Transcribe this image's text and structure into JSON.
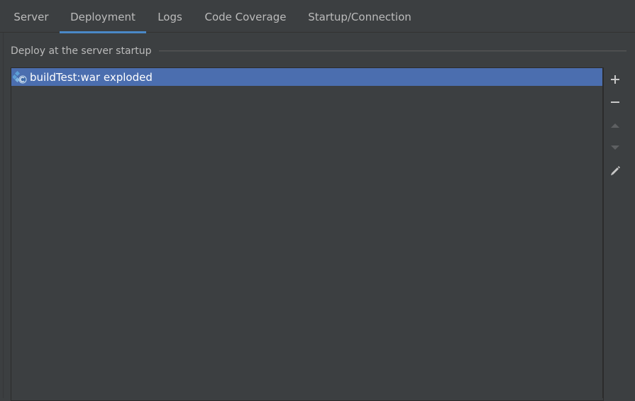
{
  "tabs": [
    {
      "label": "Server",
      "active": false
    },
    {
      "label": "Deployment",
      "active": true
    },
    {
      "label": "Logs",
      "active": false
    },
    {
      "label": "Code Coverage",
      "active": false
    },
    {
      "label": "Startup/Connection",
      "active": false
    }
  ],
  "deployment": {
    "group_title": "Deploy at the server startup",
    "items": [
      {
        "label": "buildTest:war exploded",
        "icon": "artifact-war-exploded-icon",
        "selected": true
      }
    ]
  },
  "toolbar": {
    "add": "plus-icon",
    "remove": "minus-icon",
    "move_up": "arrow-up-icon",
    "move_down": "arrow-down-icon",
    "edit": "pencil-icon"
  },
  "colors": {
    "background": "#3c3f41",
    "selection": "#4b6eaf",
    "tab_underline": "#4a88c7",
    "text": "#bbbbbb"
  }
}
